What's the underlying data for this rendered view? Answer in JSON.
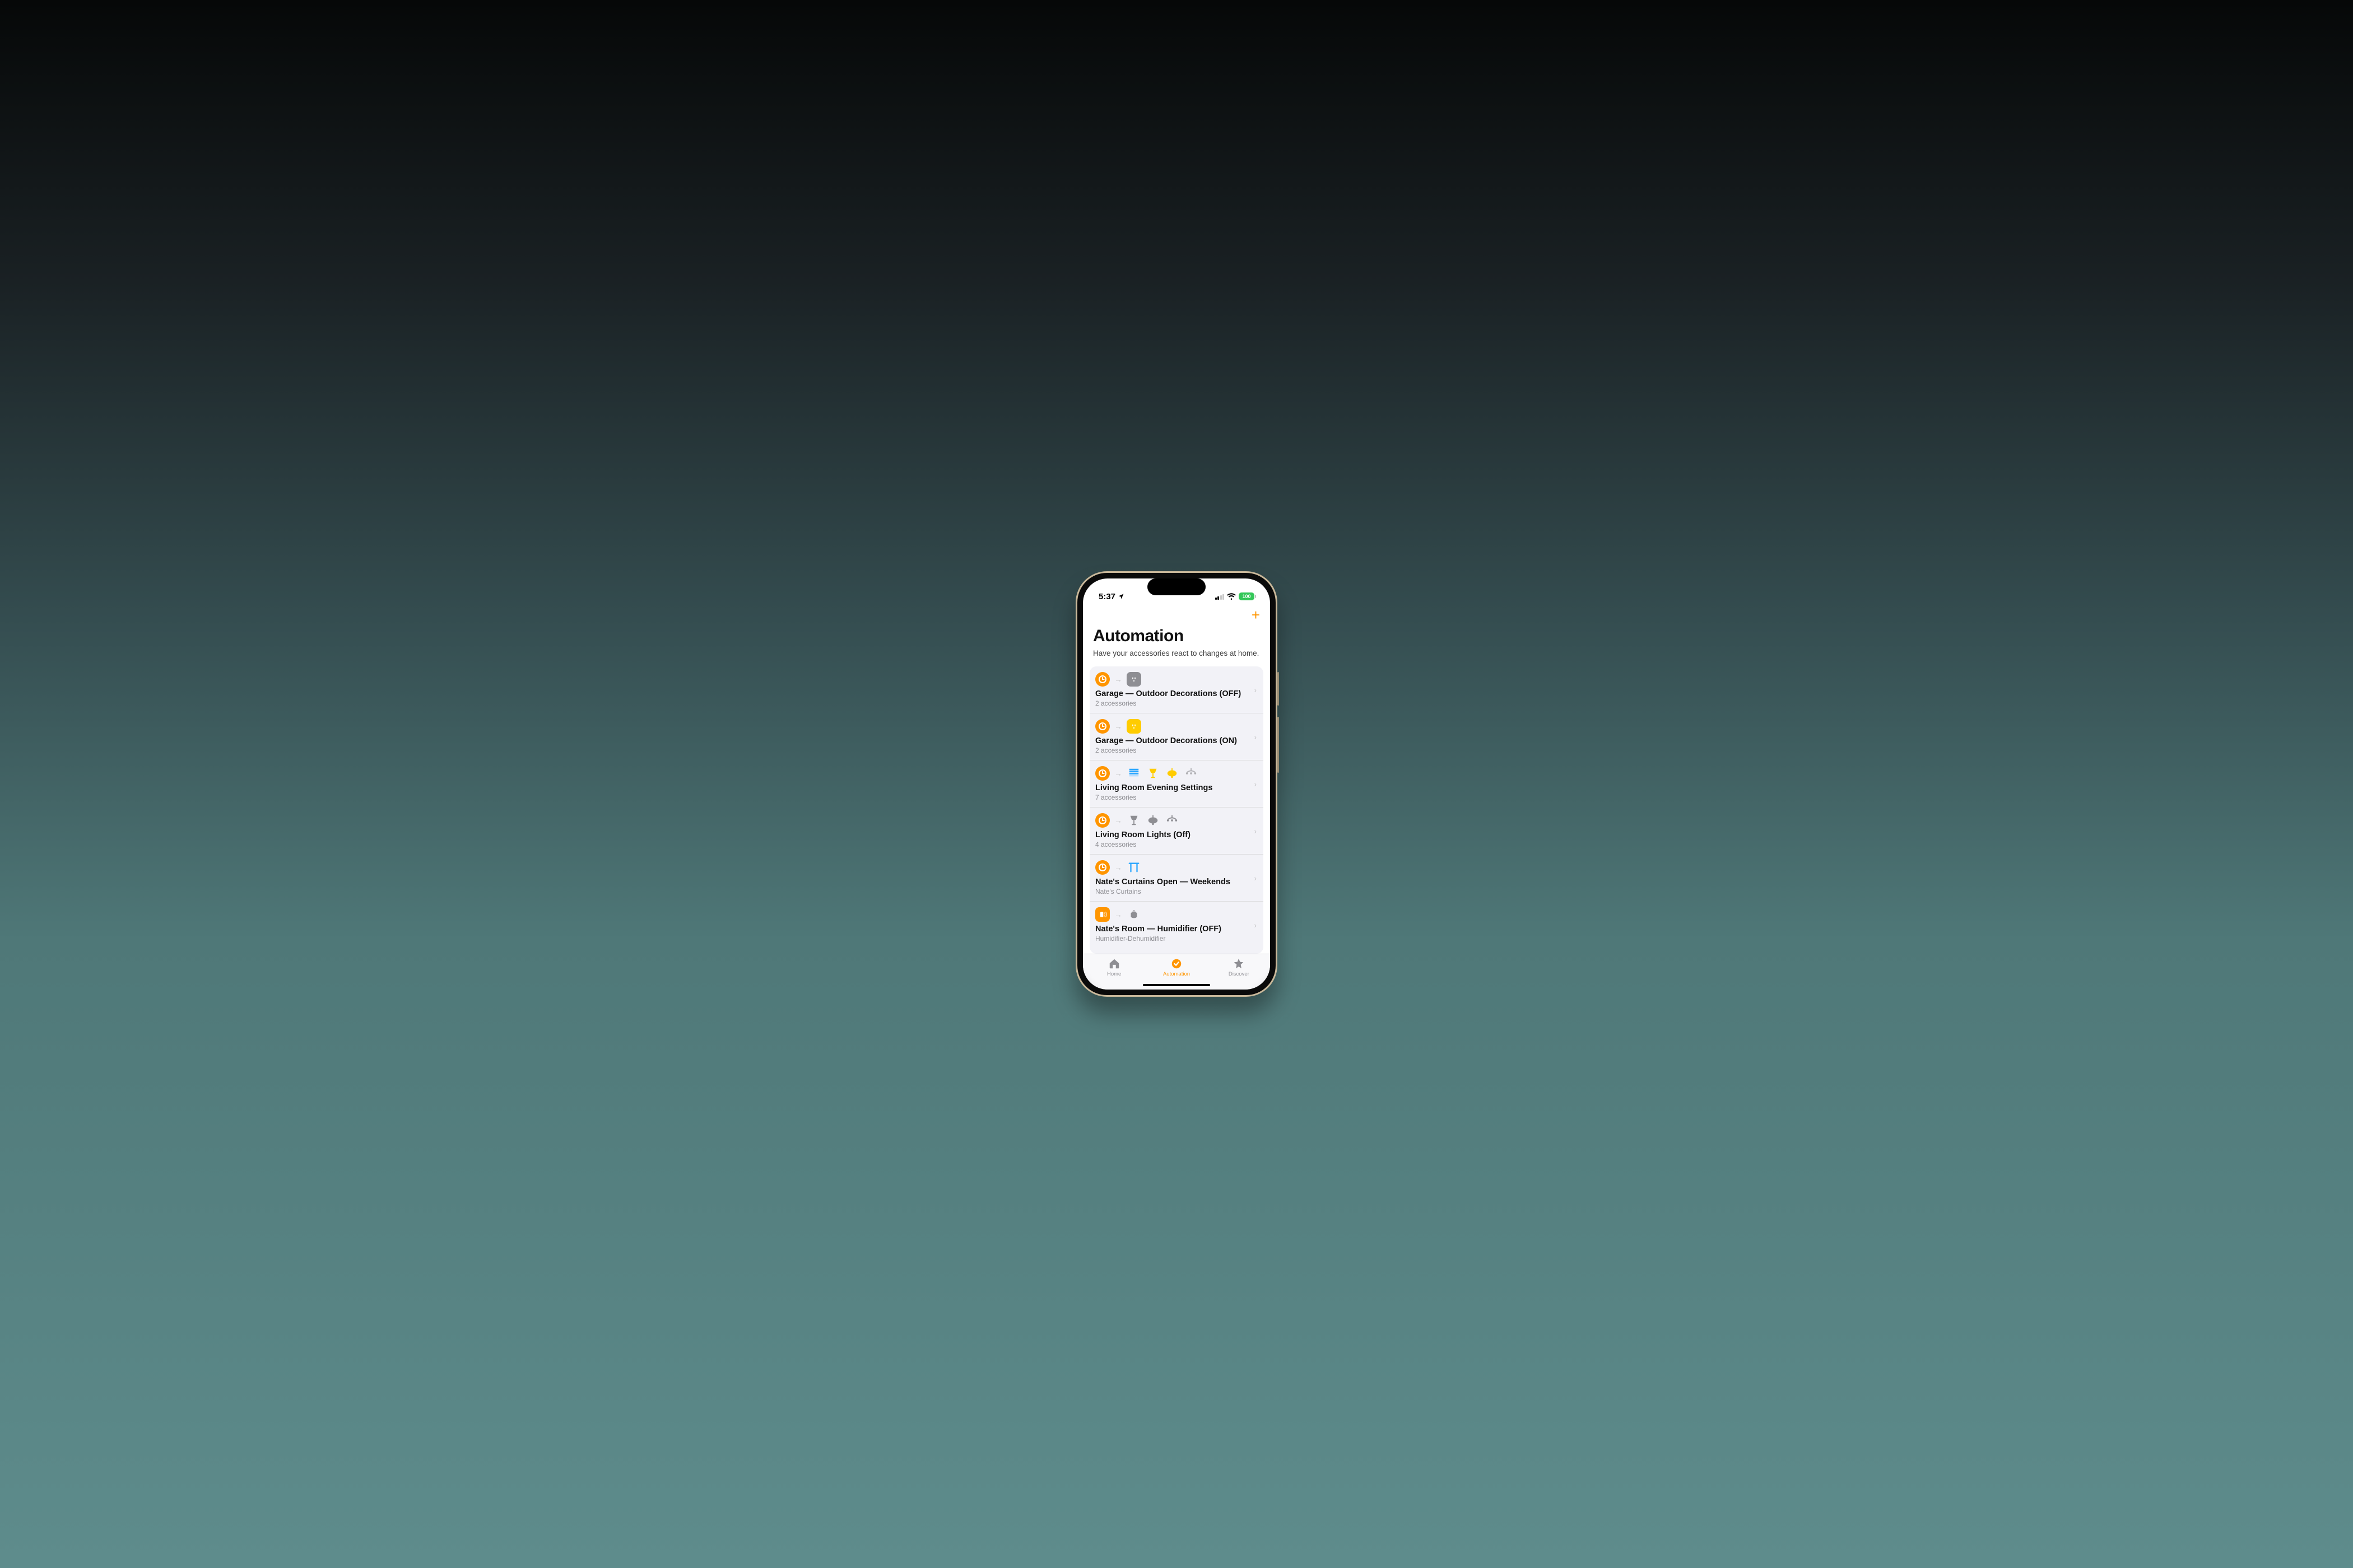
{
  "status": {
    "time": "5:37",
    "battery": "100"
  },
  "header": {
    "title": "Automation",
    "subtitle": "Have your accessories react to changes at home."
  },
  "rows": [
    {
      "title": "Garage — Outdoor Decorations (OFF)",
      "subtitle": "2 accessories",
      "trigger": "clock",
      "devices": [
        {
          "type": "outlet",
          "tone": "gray"
        }
      ]
    },
    {
      "title": "Garage — Outdoor Decorations (ON)",
      "subtitle": "2 accessories",
      "trigger": "clock",
      "devices": [
        {
          "type": "outlet",
          "tone": "yellow"
        }
      ]
    },
    {
      "title": "Living Room Evening Settings",
      "subtitle": "7 accessories",
      "trigger": "clock",
      "devices": [
        {
          "type": "blinds",
          "tone": "blue"
        },
        {
          "type": "lamp",
          "tone": "yellowfill"
        },
        {
          "type": "pendant",
          "tone": "yellowfill"
        },
        {
          "type": "chandelier",
          "tone": "grayfill"
        }
      ]
    },
    {
      "title": "Living Room Lights (Off)",
      "subtitle": "4 accessories",
      "trigger": "clock",
      "devices": [
        {
          "type": "lamp",
          "tone": "grayfill"
        },
        {
          "type": "pendant",
          "tone": "grayfill"
        },
        {
          "type": "chandelier",
          "tone": "grayfill"
        }
      ]
    },
    {
      "title": "Nate's Curtains Open — Weekends",
      "subtitle": "Nate's Curtains",
      "trigger": "clock",
      "devices": [
        {
          "type": "curtains",
          "tone": "blue"
        }
      ]
    },
    {
      "title": "Nate's Room — Humidifier (OFF)",
      "subtitle": "Humidifier-Dehumidifier",
      "trigger": "sensor",
      "devices": [
        {
          "type": "humidifier",
          "tone": "grayfill"
        }
      ]
    }
  ],
  "tabs": {
    "home": "Home",
    "automation": "Automation",
    "discover": "Discover"
  }
}
